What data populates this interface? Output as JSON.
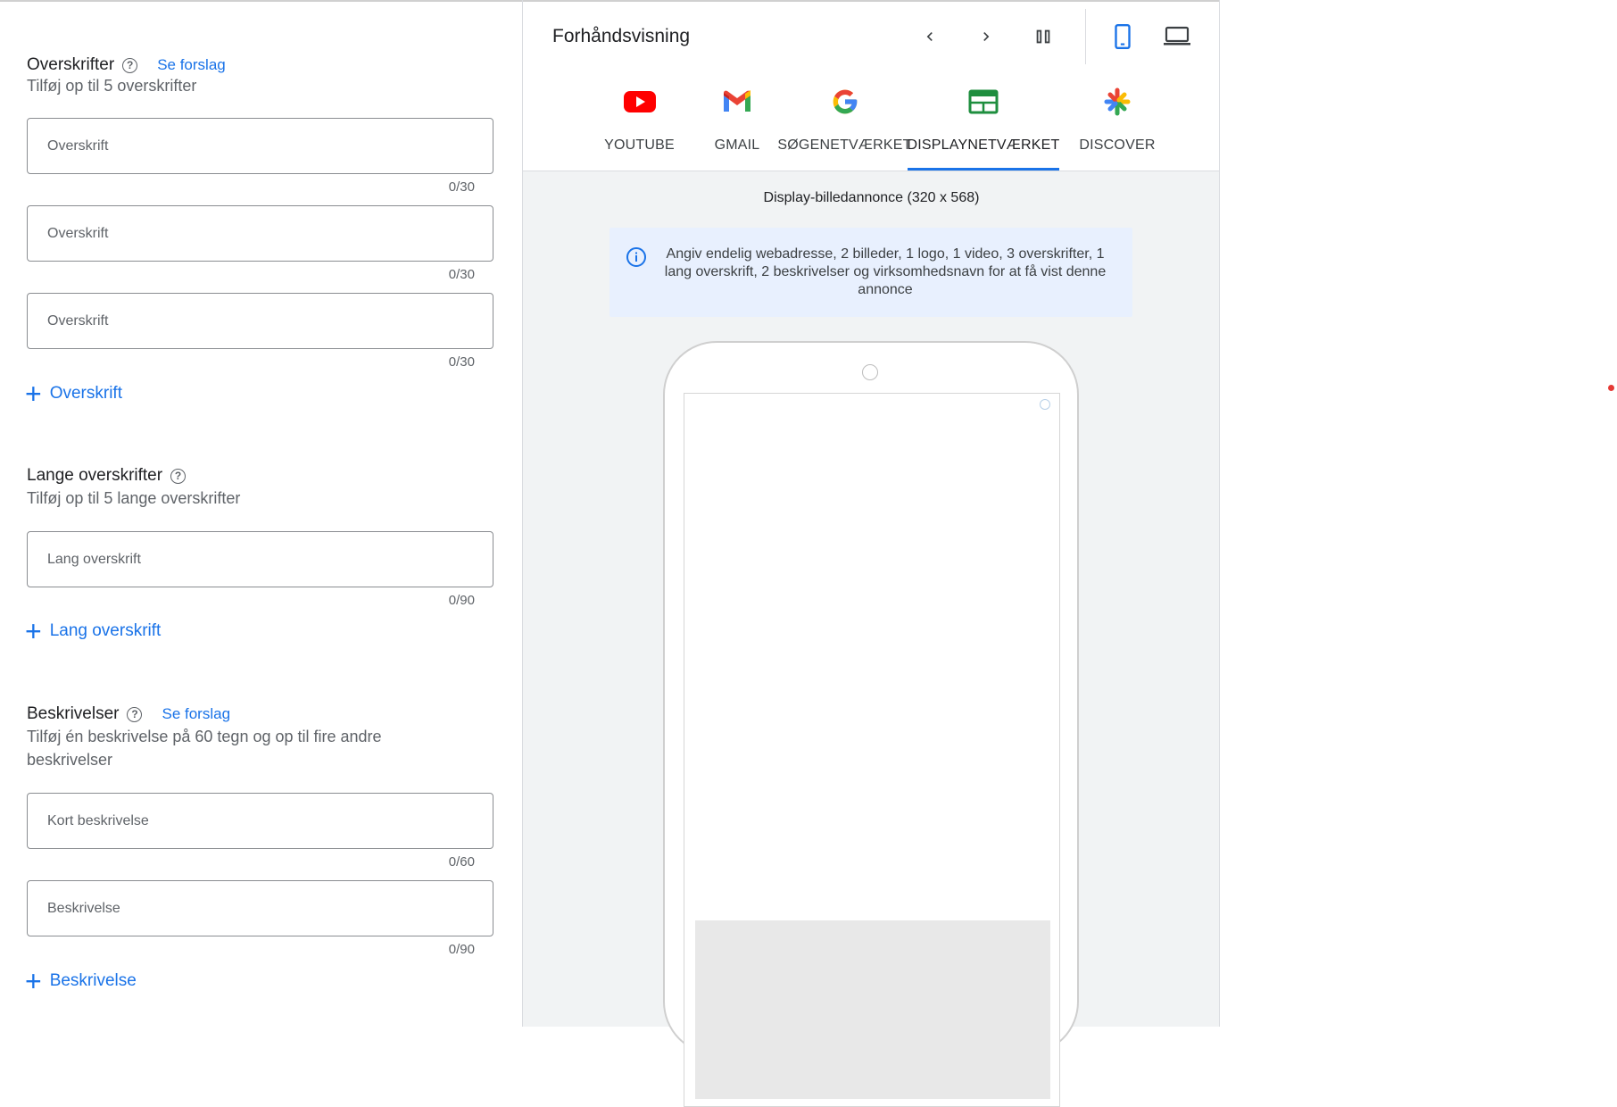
{
  "headlines": {
    "title": "Overskrifter",
    "help": "?",
    "suggest": "Se forslag",
    "subtitle": "Tilføj op til 5 overskrifter",
    "fields": [
      {
        "placeholder": "Overskrift",
        "count": "0/30"
      },
      {
        "placeholder": "Overskrift",
        "count": "0/30"
      },
      {
        "placeholder": "Overskrift",
        "count": "0/30"
      }
    ],
    "add_label": "Overskrift"
  },
  "long_headlines": {
    "title": "Lange overskrifter",
    "help": "?",
    "subtitle": "Tilføj op til 5 lange overskrifter",
    "fields": [
      {
        "placeholder": "Lang overskrift",
        "count": "0/90"
      }
    ],
    "add_label": "Lang overskrift"
  },
  "descriptions": {
    "title": "Beskrivelser",
    "help": "?",
    "suggest": "Se forslag",
    "subtitle": "Tilføj én beskrivelse på 60 tegn og op til fire andre beskrivelser",
    "fields": [
      {
        "placeholder": "Kort beskrivelse",
        "count": "0/60"
      },
      {
        "placeholder": "Beskrivelse",
        "count": "0/90"
      }
    ],
    "add_label": "Beskrivelse"
  },
  "preview": {
    "title": "Forhåndsvisning",
    "tabs": [
      {
        "label": "YOUTUBE",
        "icon": "youtube-icon"
      },
      {
        "label": "GMAIL",
        "icon": "gmail-icon"
      },
      {
        "label": "SØGENETVÆRKET",
        "icon": "google-icon"
      },
      {
        "label": "DISPLAYNETVÆRKET",
        "icon": "display-icon",
        "active": true
      },
      {
        "label": "DISCOVER",
        "icon": "discover-icon"
      }
    ],
    "ad_title": "Display-billedannonce (320 x 568)",
    "info_text": "Angiv endelig webadresse, 2 billeder, 1 logo, 1 video, 3 overskrifter, 1 lang overskrift, 2 beskrivelser og virksomhedsnavn for at få vist denne annonce"
  },
  "colors": {
    "accent": "#1a73e8",
    "info_bg": "#e8f0fe",
    "panel_bg": "#f1f3f4"
  }
}
